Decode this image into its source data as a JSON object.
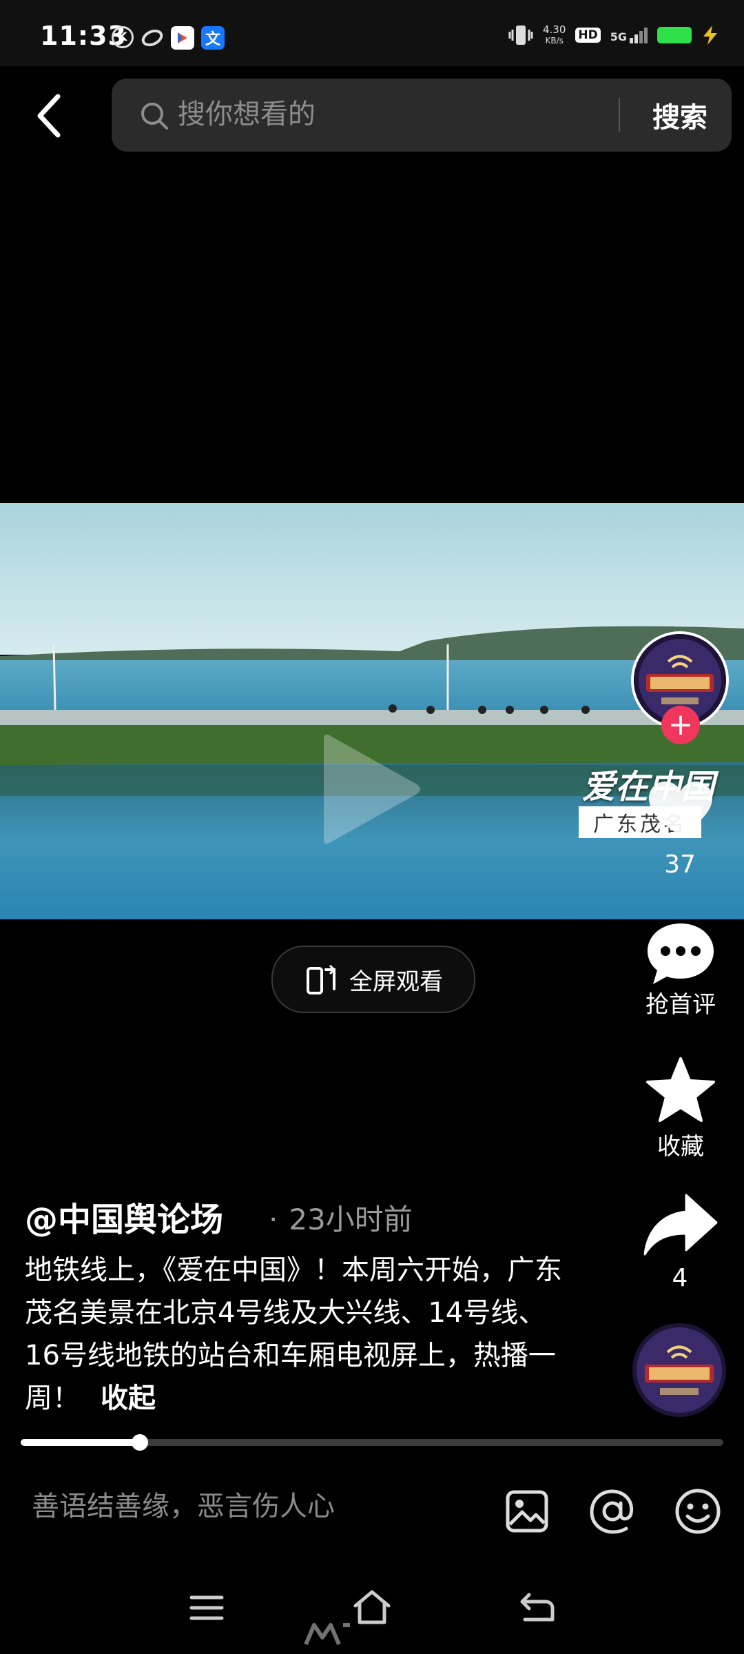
{
  "status_bar": {
    "time": "11:33",
    "net_speed_value": "4.30",
    "net_speed_unit": "KB/s",
    "hd": "HD",
    "network": "5G",
    "battery_color": "#2ee04a",
    "icons_left": [
      "k-icon",
      "swirl-icon",
      "app-icon",
      "translate-icon"
    ]
  },
  "search": {
    "placeholder": "搜你想看的",
    "button_label": "搜索"
  },
  "video": {
    "overlay_title": "爱在中国",
    "overlay_subtitle": "广东茂名",
    "fullscreen_label": "全屏观看",
    "progress_fraction": 0.17
  },
  "actions": {
    "follow_symbol": "+",
    "like_count": "37",
    "comment_label": "抢首评",
    "favorite_label": "收藏",
    "share_count": "4",
    "accent": "#f0365b"
  },
  "post": {
    "author": "@中国舆论场",
    "time_separator": "·",
    "time_ago": "23小时前",
    "caption": "地铁线上，《爱在中国》！本周六开始，广东茂名美景在北京4号线及大兴线、14号线、16号线地铁的站台和车厢电视屏上，热播一周！",
    "collapse_label": "收起"
  },
  "comment_bar": {
    "placeholder": "善语结善缘，恶言伤人心"
  }
}
